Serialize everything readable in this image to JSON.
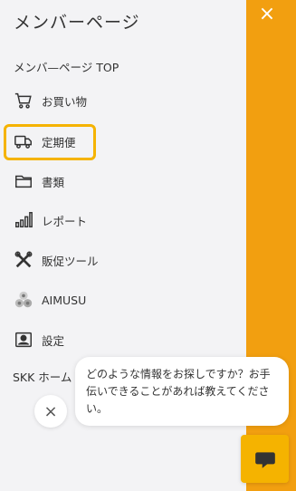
{
  "header": {
    "title": "メンバーページ"
  },
  "top_link": "メンバ—ページ TOP",
  "menu": [
    {
      "label": "お買い物",
      "icon": "shopping-cart-icon"
    },
    {
      "label": "定期便",
      "icon": "delivery-truck-icon"
    },
    {
      "label": "書類",
      "icon": "folder-icon"
    },
    {
      "label": "レポート",
      "icon": "bar-chart-icon"
    },
    {
      "label": "販促ツール",
      "icon": "tools-icon"
    },
    {
      "label": "AIMUSU",
      "icon": "aimusu-logo-icon"
    },
    {
      "label": "設定",
      "icon": "user-settings-icon"
    }
  ],
  "skk_label": "SKK ホーム",
  "chat": {
    "message": "どのような情報をお探しですか？お手伝いできることがあれば教えてください。",
    "close_symbol": "×"
  },
  "panel": {
    "close_symbol": "×"
  },
  "colors": {
    "accent": "#f29f10",
    "highlight": "#f5b300",
    "background": "#f3f3f5"
  }
}
